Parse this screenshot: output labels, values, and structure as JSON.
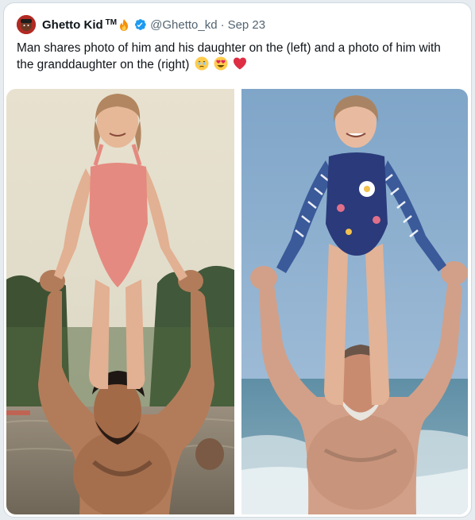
{
  "tweet": {
    "author_name": "Ghetto Kid",
    "trademark": "TM",
    "handle": "@Ghetto_kd",
    "separator": "·",
    "date": "Sep 23",
    "text": "Man shares photo of him and his daughter on the (left) and a photo of him with the granddaughter on the (right)"
  },
  "icons": {
    "fire": "fire-icon",
    "verified": "verified-badge-icon",
    "emoji_1": "face-holding-back-tears-emoji",
    "emoji_2": "heart-eyes-emoji",
    "emoji_3": "red-heart-emoji"
  },
  "colors": {
    "verified_blue": "#1d9bf0",
    "text_primary": "#0f1419",
    "text_secondary": "#536471",
    "avatar_red": "#b22a23"
  }
}
